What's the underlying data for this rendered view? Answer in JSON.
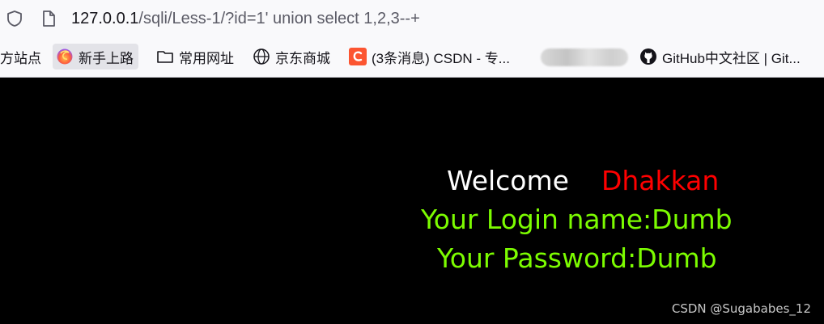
{
  "address_bar": {
    "url_host": "127.0.0.1",
    "url_path": "/sqli/Less-1/?id=1' union select 1,2,3--+"
  },
  "bookmarks": [
    {
      "label": "方站点",
      "icon": "none"
    },
    {
      "label": "新手上路",
      "icon": "firefox-icon"
    },
    {
      "label": "常用网址",
      "icon": "folder-icon"
    },
    {
      "label": "京东商城",
      "icon": "globe-icon"
    },
    {
      "label": "(3条消息) CSDN - 专...",
      "icon": "csdn-icon"
    },
    {
      "label": "GitHub中文社区 | Git...",
      "icon": "github-icon"
    }
  ],
  "page": {
    "welcome": "Welcome",
    "name": "Dhakkan",
    "login_line": "Your Login name:Dumb",
    "password_line": "Your Password:Dumb"
  },
  "watermark": "CSDN @Sugababes_12",
  "colors": {
    "welcome": "#ffffff",
    "name": "#ff0000",
    "result": "#7cfc00",
    "background": "#000000"
  }
}
